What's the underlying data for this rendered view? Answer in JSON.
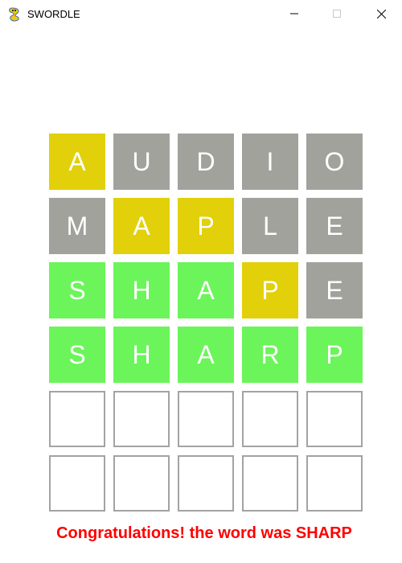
{
  "window": {
    "title": "SWORDLE",
    "controls": {
      "minimize": "minimize-icon",
      "maximize": "maximize-icon",
      "close": "close-icon"
    }
  },
  "colors": {
    "correct": "#6bf55a",
    "present": "#e2d00a",
    "absent": "#a2a29d",
    "empty_border": "#a3a3a3",
    "message": "#ff0000",
    "letter": "#ffffff"
  },
  "board": {
    "rows": [
      [
        {
          "letter": "A",
          "state": "present"
        },
        {
          "letter": "U",
          "state": "absent"
        },
        {
          "letter": "D",
          "state": "absent"
        },
        {
          "letter": "I",
          "state": "absent"
        },
        {
          "letter": "O",
          "state": "absent"
        }
      ],
      [
        {
          "letter": "M",
          "state": "absent"
        },
        {
          "letter": "A",
          "state": "present"
        },
        {
          "letter": "P",
          "state": "present"
        },
        {
          "letter": "L",
          "state": "absent"
        },
        {
          "letter": "E",
          "state": "absent"
        }
      ],
      [
        {
          "letter": "S",
          "state": "correct"
        },
        {
          "letter": "H",
          "state": "correct"
        },
        {
          "letter": "A",
          "state": "correct"
        },
        {
          "letter": "P",
          "state": "present"
        },
        {
          "letter": "E",
          "state": "absent"
        }
      ],
      [
        {
          "letter": "S",
          "state": "correct"
        },
        {
          "letter": "H",
          "state": "correct"
        },
        {
          "letter": "A",
          "state": "correct"
        },
        {
          "letter": "R",
          "state": "correct"
        },
        {
          "letter": "P",
          "state": "correct"
        }
      ],
      [
        {
          "letter": "",
          "state": "empty"
        },
        {
          "letter": "",
          "state": "empty"
        },
        {
          "letter": "",
          "state": "empty"
        },
        {
          "letter": "",
          "state": "empty"
        },
        {
          "letter": "",
          "state": "empty"
        }
      ],
      [
        {
          "letter": "",
          "state": "empty"
        },
        {
          "letter": "",
          "state": "empty"
        },
        {
          "letter": "",
          "state": "empty"
        },
        {
          "letter": "",
          "state": "empty"
        },
        {
          "letter": "",
          "state": "empty"
        }
      ]
    ]
  },
  "message": "Congratulations! the word was SHARP"
}
